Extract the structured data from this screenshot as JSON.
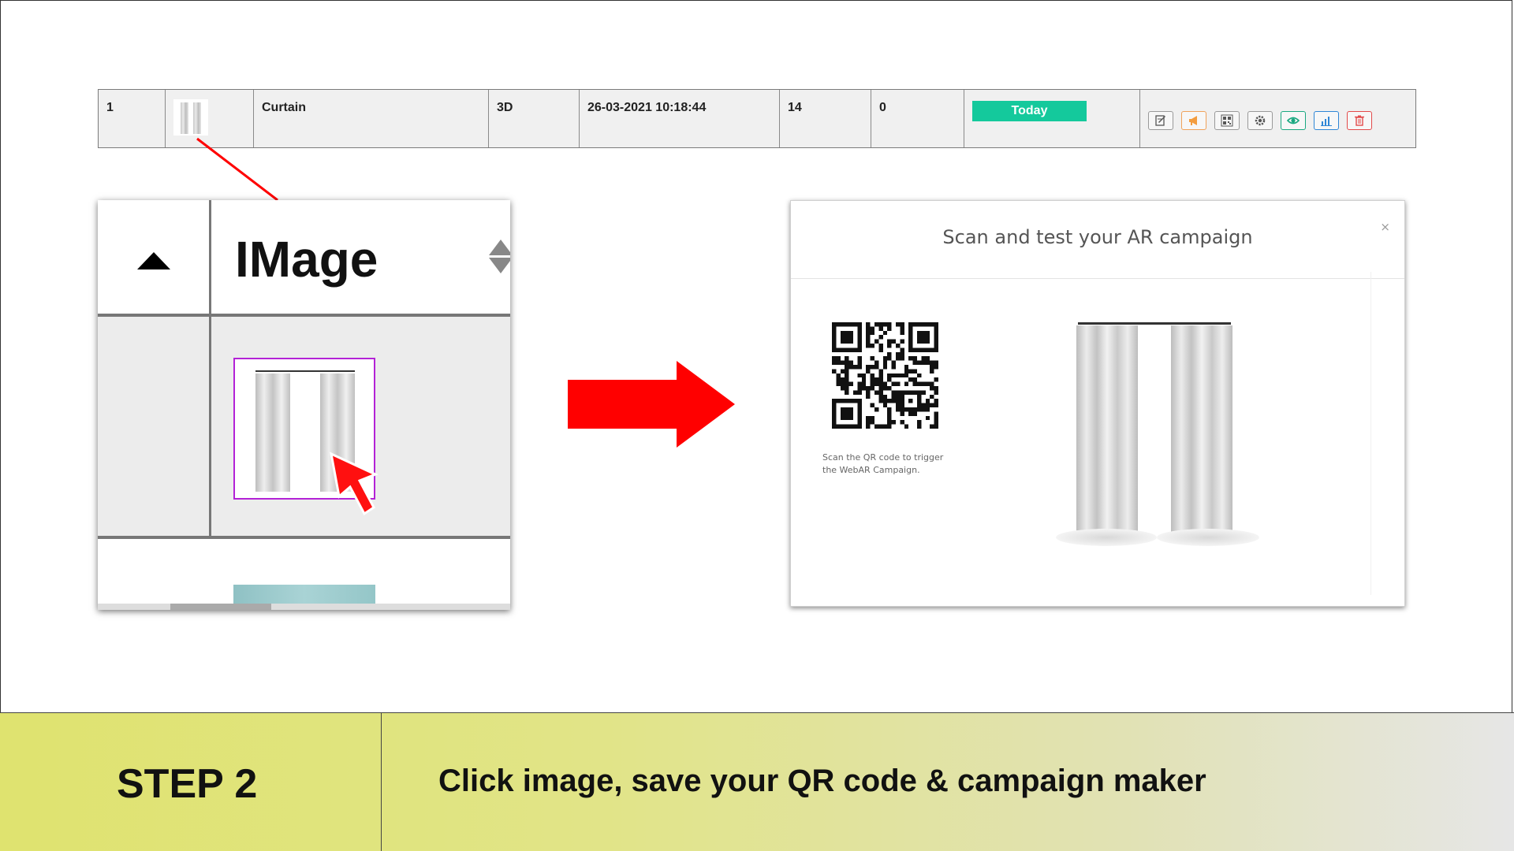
{
  "table_row": {
    "index": "1",
    "name": "Curtain",
    "type": "3D",
    "datetime": "26-03-2021  10:18:44",
    "count_a": "14",
    "count_b": "0",
    "status": "Today",
    "status_color": "#14c99c",
    "actions": [
      {
        "icon": "edit-icon",
        "color": "#555555"
      },
      {
        "icon": "megaphone-icon",
        "color": "#f39c3f"
      },
      {
        "icon": "qr-code-icon",
        "color": "#555555"
      },
      {
        "icon": "gear-icon",
        "color": "#555555"
      },
      {
        "icon": "eye-icon",
        "color": "#1aa881"
      },
      {
        "icon": "bar-chart-icon",
        "color": "#2f86d6"
      },
      {
        "icon": "trash-icon",
        "color": "#e34a4a"
      }
    ]
  },
  "zoom": {
    "column_title": "IMage",
    "sort_icon": "triangle-up-icon",
    "sort_toggle_icon": "sort-icon"
  },
  "modal": {
    "title": "Scan and test your AR campaign",
    "close": "×",
    "qr_caption": "Scan the QR code to trigger the WebAR Campaign."
  },
  "banner": {
    "step": "STEP 2",
    "instruction": "Click image, save your QR code & campaign maker"
  },
  "colors": {
    "arrow": "#ff0000",
    "highlight_border": "#b322d6",
    "connector": "#ff0000"
  }
}
